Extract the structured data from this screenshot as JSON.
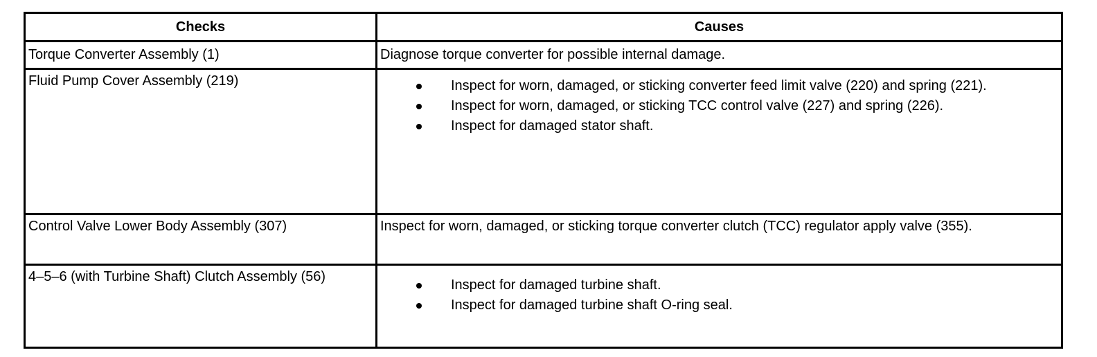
{
  "table": {
    "headers": {
      "checks": "Checks",
      "causes": "Causes"
    },
    "rows": [
      {
        "check": "Torque Converter Assembly (1)",
        "cause": "Diagnose torque converter for possible internal damage."
      },
      {
        "check": "Fluid Pump Cover Assembly (219)",
        "causes": [
          "Inspect for worn, damaged, or sticking converter feed limit valve (220) and spring (221).",
          "Inspect for worn, damaged, or sticking TCC control valve (227) and spring (226).",
          "Inspect for damaged stator shaft."
        ]
      },
      {
        "check": "Control Valve Lower Body Assembly (307)",
        "cause": "Inspect for worn, damaged, or sticking torque converter clutch (TCC) regulator apply valve (355)."
      },
      {
        "check": "4–5–6 (with Turbine Shaft) Clutch Assembly (56)",
        "causes": [
          "Inspect for damaged turbine shaft.",
          "Inspect for damaged turbine shaft O-ring seal."
        ]
      }
    ]
  }
}
